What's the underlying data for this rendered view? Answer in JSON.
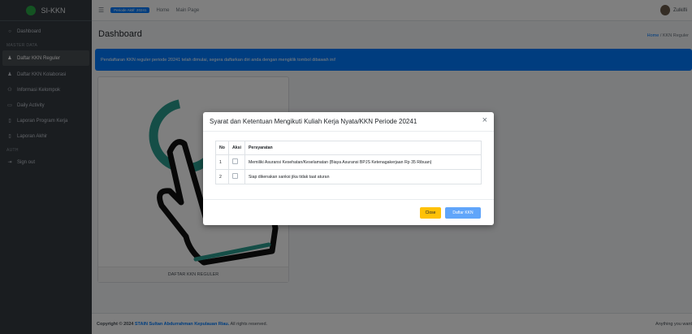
{
  "brand": {
    "name": "SI-KKN",
    "logo_color": "#28a745"
  },
  "sidebar": {
    "items": [
      {
        "label": "Dashboard",
        "icon": "circle-icon"
      }
    ],
    "section_master": "MASTER DATA",
    "master_items": [
      {
        "label": "Daftar KKN Reguler",
        "icon": "person-icon",
        "active": true
      },
      {
        "label": "Daftar KKN Kolaborasi",
        "icon": "person-icon"
      },
      {
        "label": "Informasi Kelompok",
        "icon": "group-icon"
      },
      {
        "label": "Daily Activity",
        "icon": "clipboard-icon"
      },
      {
        "label": "Laporan Program Kerja",
        "icon": "file-icon"
      },
      {
        "label": "Laporan Akhir",
        "icon": "file-icon"
      }
    ],
    "section_auth": "AUTH",
    "auth_items": [
      {
        "label": "Sign out",
        "icon": "signout-icon"
      }
    ]
  },
  "navbar": {
    "periode_badge": "Periode Aktif: 20241",
    "links": [
      "Home",
      "Main Page"
    ],
    "user_name": "Zulkifli"
  },
  "content": {
    "title": "Dashboard",
    "breadcrumb_home": "Home",
    "breadcrumb_sep": "/",
    "breadcrumb_current": "KKN Reguler",
    "alert": "Pendaftaran KKN reguler periode 20241 telah dimulai, segera daftarkan diri anda dengan mengklik tombol dibawah ini!",
    "card_label": "DAFTAR KKN REGULER"
  },
  "footer": {
    "copyright_prefix": "Copyright © 2024",
    "institution": "STAIN Sultan Abdurrahman Kepulauan Riau.",
    "suffix": "All rights reserved.",
    "right": "Anything you want"
  },
  "modal": {
    "title": "Syarat dan Ketentuan Mengikuti Kuliah Kerja Nyata/KKN Periode 20241",
    "columns": [
      "No",
      "Aksi",
      "Persyaratan"
    ],
    "rows": [
      {
        "no": "1",
        "text": "Memiliki Asuransi Kesehatan/Keselamatan (Biaya Asuransi BPJS Ketenagakerjaan Rp 35 Ribuan)"
      },
      {
        "no": "2",
        "text": "Siap dikenakan sanksi jika tidak taat aturan"
      }
    ],
    "close_label": "Close",
    "submit_label": "Daftar KKN"
  },
  "colors": {
    "primary": "#007bff",
    "warning": "#ffc107",
    "sidebar": "#343a40"
  }
}
